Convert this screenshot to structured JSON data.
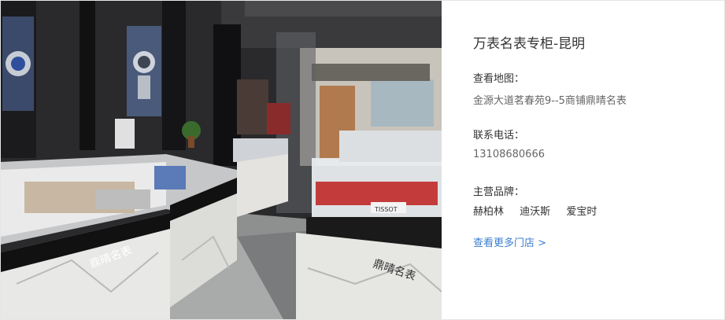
{
  "store": {
    "title": "万表名表专柜-昆明",
    "photo_alt": "鼎晴名表",
    "map": {
      "label": "查看地图：",
      "address": "金源大道茗春苑9--5商铺鼎晴名表"
    },
    "phone": {
      "label": "联系电话：",
      "number": "13108680666"
    },
    "brands": {
      "label": "主营品牌：",
      "items": [
        "赫柏林",
        "迪沃斯",
        "爱宝时"
      ]
    },
    "more_link": "查看更多门店 >"
  },
  "photo_signage": {
    "counter_front_left": "鼎晴名表",
    "counter_front_right": "鼎晴名表",
    "tissot_sign": "TISSOT"
  },
  "colors": {
    "link": "#3b7ed0",
    "title": "#333333",
    "muted": "#666666"
  }
}
